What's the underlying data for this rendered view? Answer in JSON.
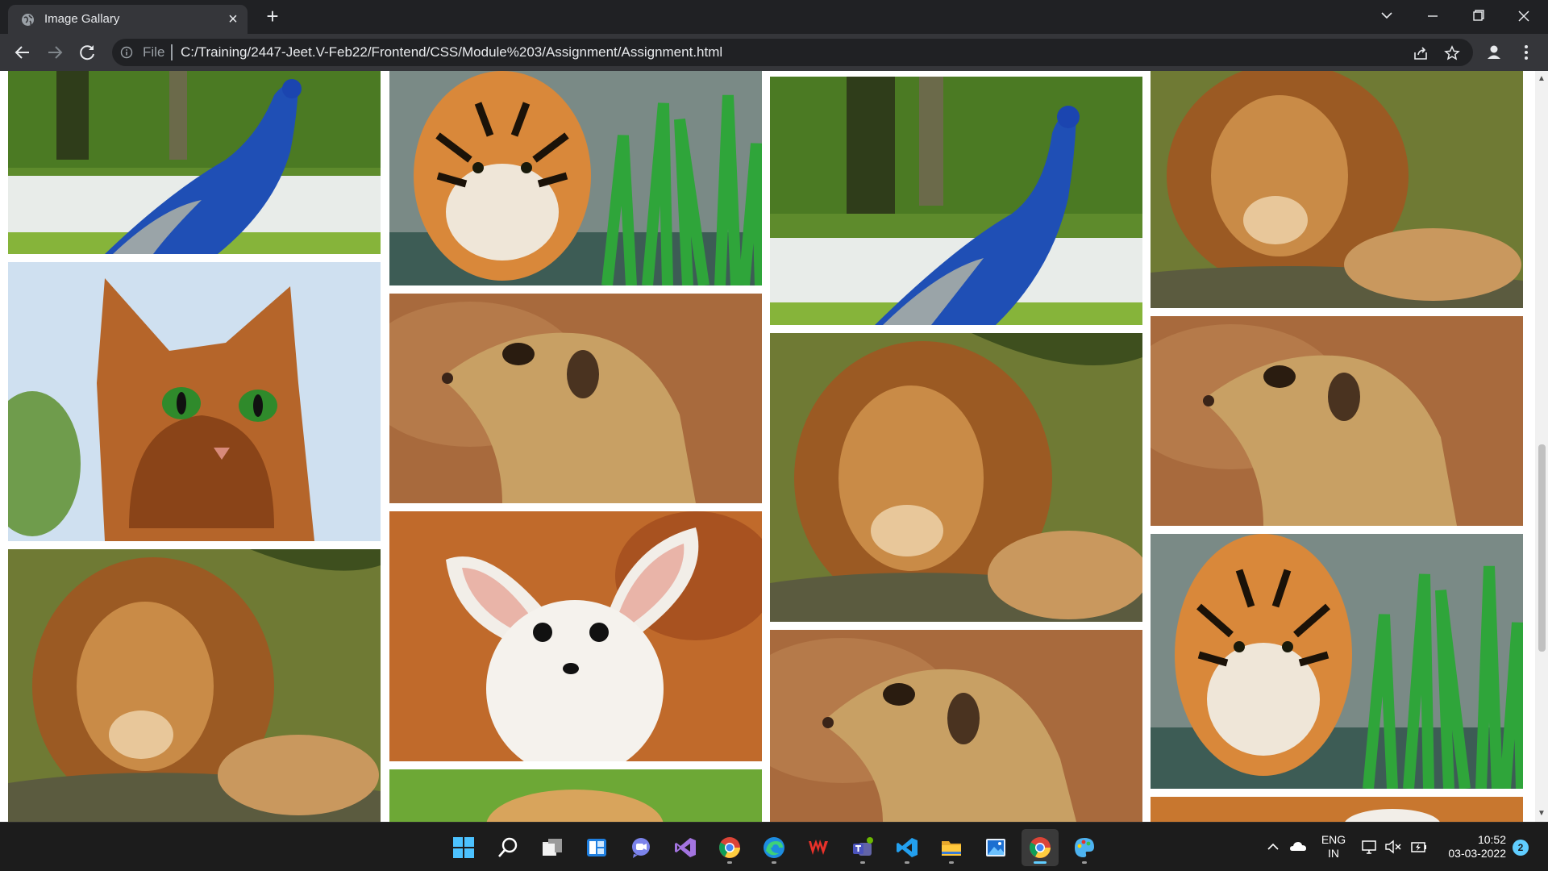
{
  "browser": {
    "tab_title": "Image Gallary",
    "tab_close": "×",
    "new_tab": "+",
    "scheme_label": "File",
    "url": "C:/Training/2447-Jeet.V-Feb22/Frontend/CSS/Module%203/Assignment/Assignment.html"
  },
  "gallery": {
    "columns": [
      {
        "images": [
          "peacock",
          "cat",
          "lion"
        ]
      },
      {
        "images": [
          "tiger",
          "meerkat",
          "fennec-fox",
          "green-animal"
        ]
      },
      {
        "images": [
          "peacock",
          "lion",
          "meerkat"
        ]
      },
      {
        "images": [
          "lion",
          "meerkat",
          "tiger",
          "orange-animal"
        ]
      }
    ]
  },
  "taskbar": {
    "apps": [
      "start-icon",
      "search-icon",
      "task-view-icon",
      "widgets-icon",
      "chat-icon",
      "visual-studio-icon",
      "chrome-icon",
      "edge-icon",
      "wps-office-icon",
      "teams-icon",
      "vscode-icon",
      "file-explorer-icon",
      "photos-icon",
      "chrome-icon",
      "paint-icon"
    ],
    "language_line1": "ENG",
    "language_line2": "IN",
    "time": "10:52",
    "date": "03-03-2022",
    "notification_count": "2"
  },
  "colors": {
    "chrome_dark": "#202124",
    "toolbar": "#35363a",
    "accent": "#60cdff"
  }
}
